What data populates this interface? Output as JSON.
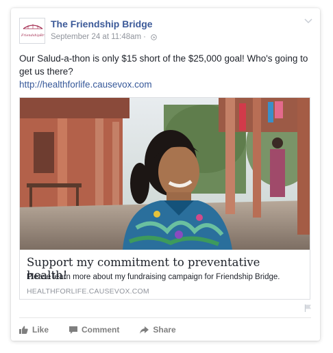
{
  "post": {
    "page_name": "The Friendship Bridge",
    "avatar_text": "FriendshipBridge",
    "timestamp": "September 24 at 11:48am",
    "separator": "·",
    "text": "Our Salud-a-thon is only $15 short of the $25,000 goal! Who's going to get us there?",
    "link": "http://healthforlife.causevox.com"
  },
  "attachment": {
    "title": "Support my commitment to preventative health!",
    "description": "Please learn more about my fundraising campaign for Friendship Bridge.",
    "domain": "HEALTHFORLIFE.CAUSEVOX.COM"
  },
  "actions": {
    "like": "Like",
    "comment": "Comment",
    "share": "Share"
  },
  "colors": {
    "link": "#3b5998",
    "meta": "#90949c",
    "action": "#7f7f7f"
  }
}
